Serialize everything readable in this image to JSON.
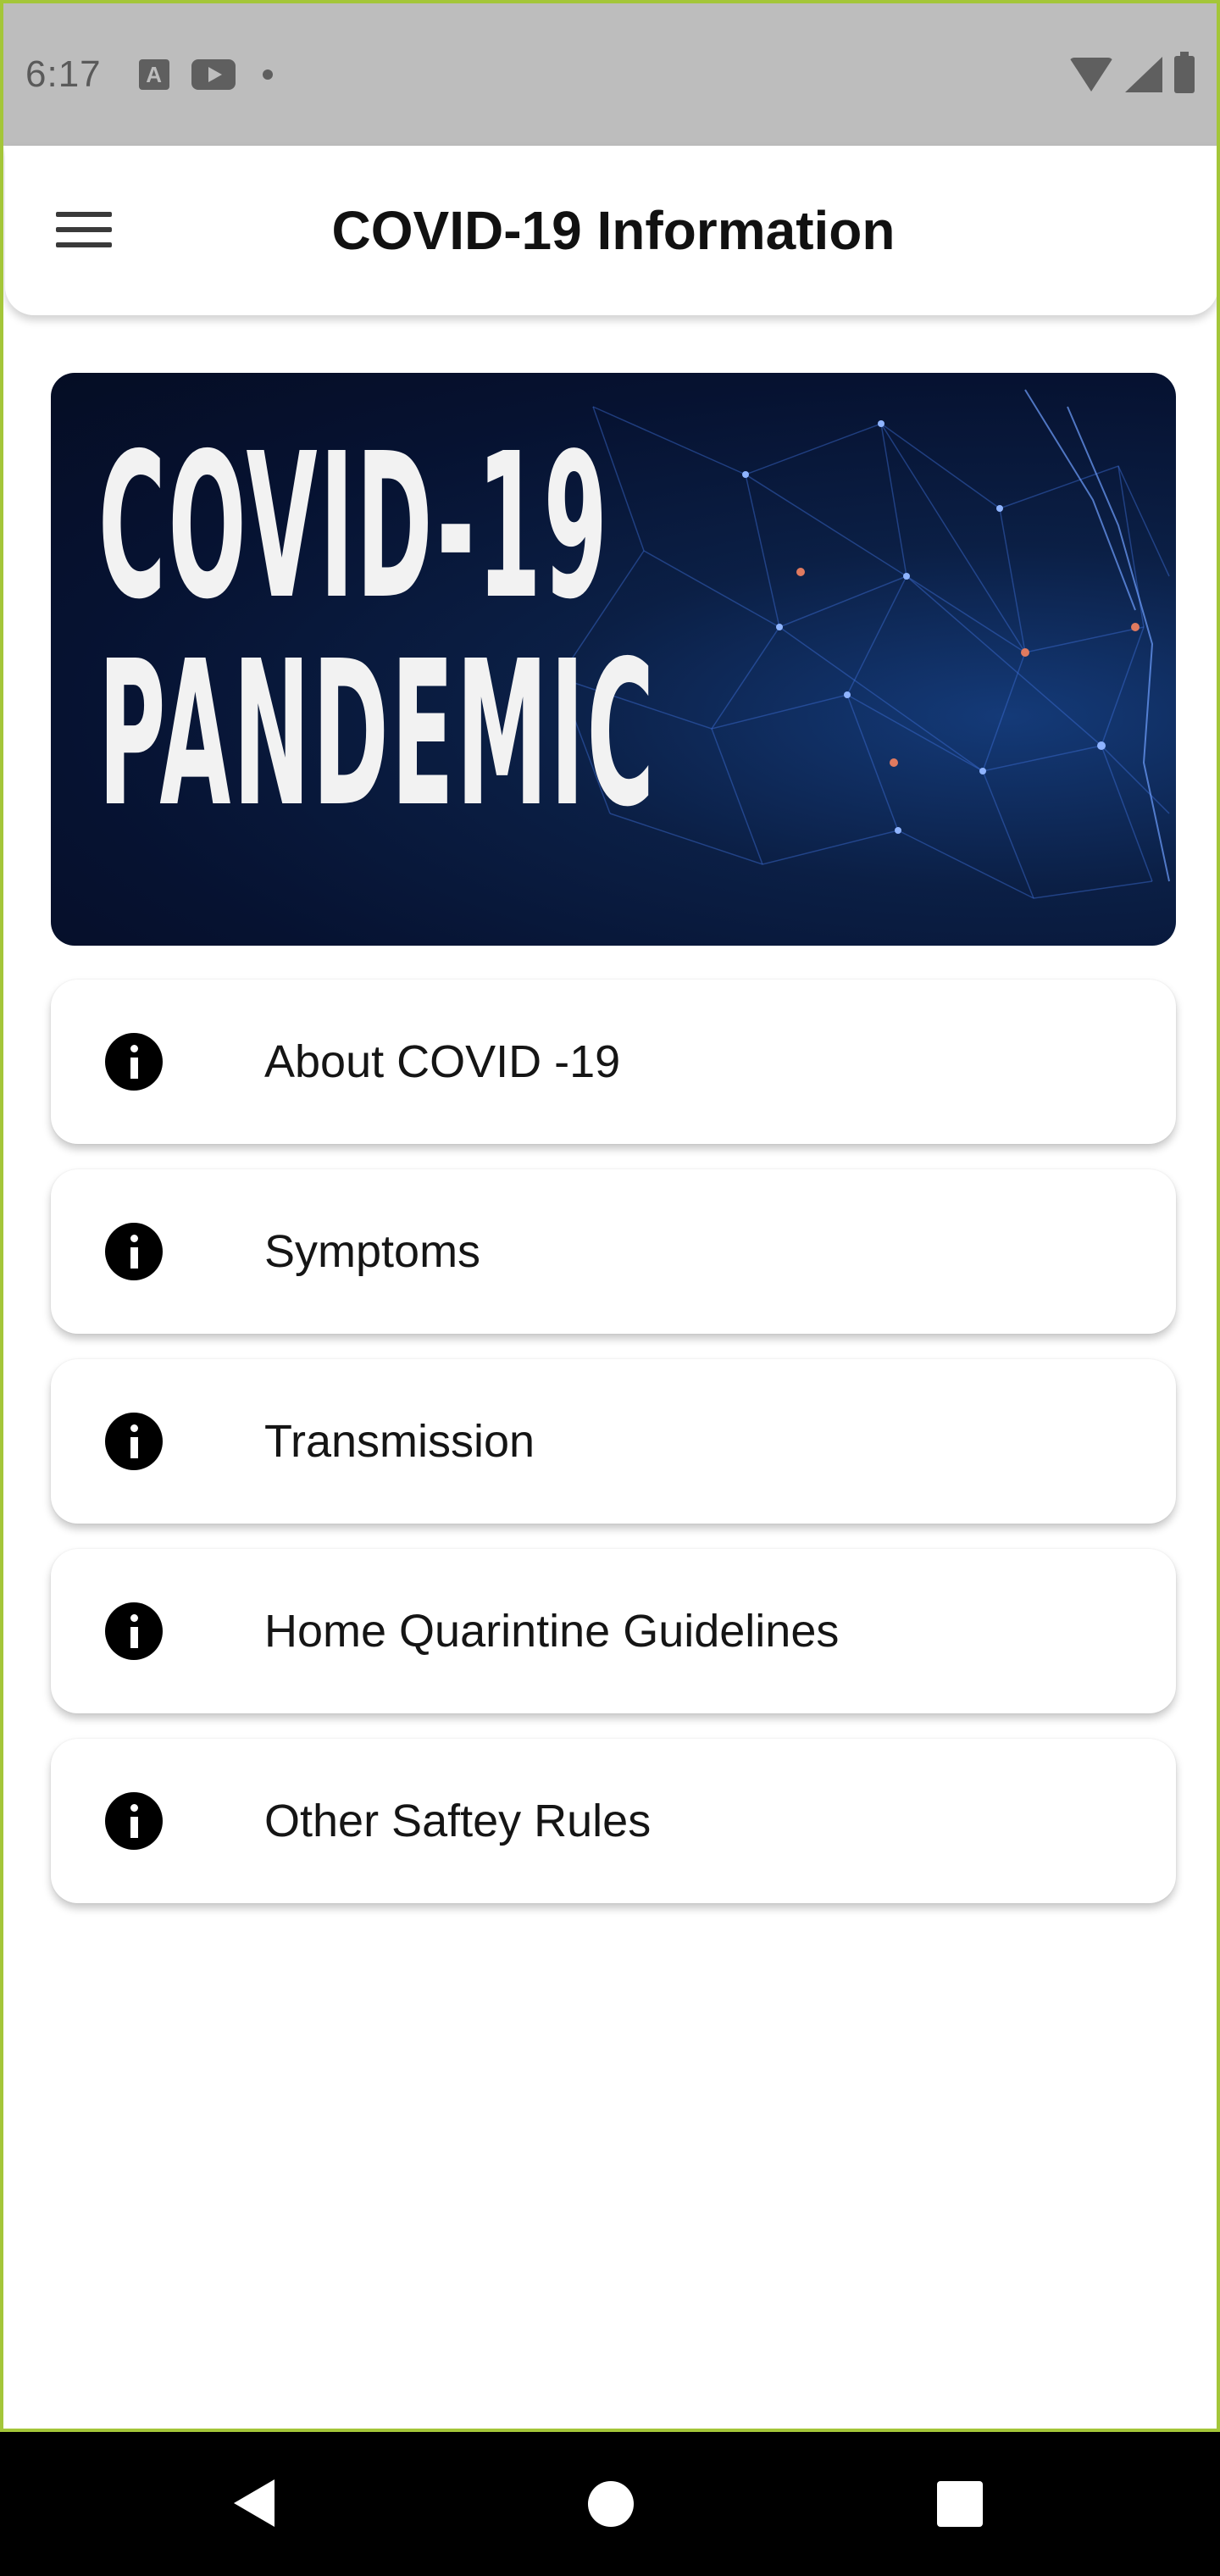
{
  "status_bar": {
    "time": "6:17",
    "left_icons": [
      "text-a-icon",
      "youtube-icon",
      "dot-icon"
    ],
    "right_icons": [
      "wifi-icon",
      "signal-icon",
      "battery-icon"
    ]
  },
  "app_bar": {
    "title": "COVID-19 Information",
    "menu_icon": "hamburger-menu-icon"
  },
  "hero": {
    "line1": "COVID-19",
    "line2": "PANDEMIC"
  },
  "menu_items": [
    {
      "label": "About COVID -19",
      "icon": "info-icon"
    },
    {
      "label": "Symptoms",
      "icon": "info-icon"
    },
    {
      "label": "Transmission",
      "icon": "info-icon"
    },
    {
      "label": "Home Quarintine Guidelines",
      "icon": "info-icon"
    },
    {
      "label": "Other Saftey Rules",
      "icon": "info-icon"
    }
  ],
  "nav_bar": {
    "icons": [
      "back-icon",
      "home-icon",
      "recents-icon"
    ]
  },
  "colors": {
    "frame_border": "#a4c639",
    "status_bar": "#bdbdbd",
    "hero_background": "#061231",
    "nav_bar": "#000000"
  }
}
